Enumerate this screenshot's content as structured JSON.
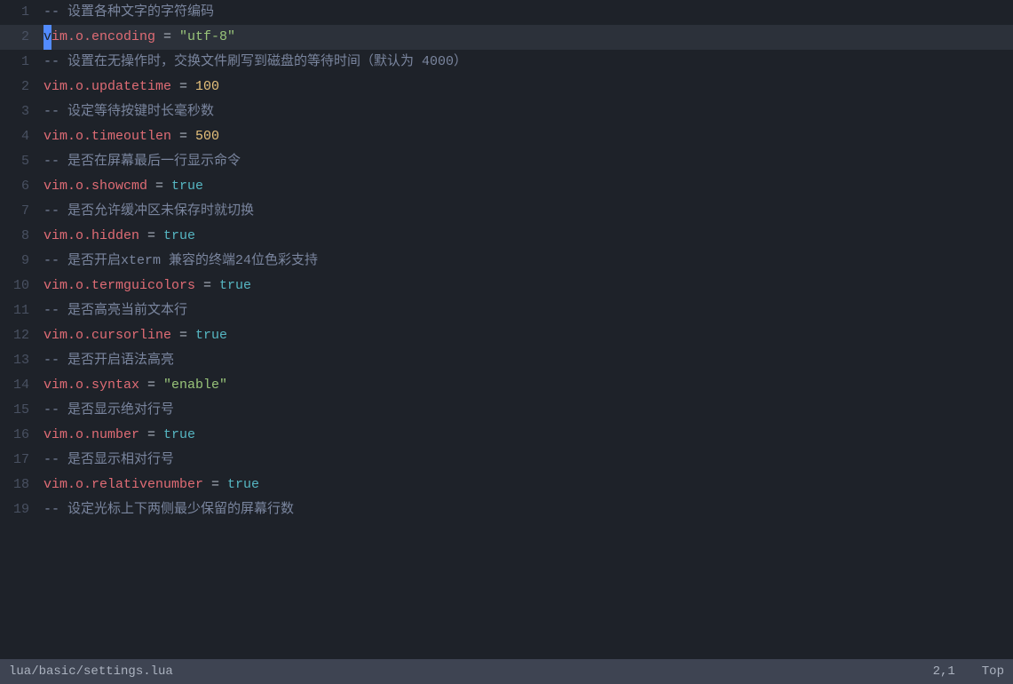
{
  "editor": {
    "lines": [
      {
        "num": "1",
        "type": "comment",
        "text": "-- 设置各种文字的字符编码",
        "isCursorLine": false
      },
      {
        "num": "2",
        "type": "code",
        "isCursorLine": true,
        "parts": [
          {
            "type": "cursor",
            "text": "v"
          },
          {
            "type": "property",
            "text": "im.o.encoding"
          },
          {
            "type": "operator",
            "text": " = "
          },
          {
            "type": "string",
            "text": "\"utf-8\""
          }
        ]
      },
      {
        "num": "1",
        "type": "comment",
        "text": "-- 设置在无操作时，交换文件刷写到磁盘的等待时间（默认为 4000）",
        "isCursorLine": false
      },
      {
        "num": "2",
        "type": "code_simple",
        "isCursorLine": false,
        "prefix": "vim.o.updatetime = ",
        "value": "100",
        "valueType": "number"
      },
      {
        "num": "3",
        "type": "comment",
        "text": "-- 设定等待按键时长毫秒数",
        "isCursorLine": false
      },
      {
        "num": "4",
        "type": "code_simple",
        "isCursorLine": false,
        "prefix": "vim.o.timeoutlen = ",
        "value": "500",
        "valueType": "number"
      },
      {
        "num": "5",
        "type": "comment",
        "text": "-- 是否在屏幕最后一行显示命令",
        "isCursorLine": false
      },
      {
        "num": "6",
        "type": "code_simple",
        "isCursorLine": false,
        "prefix": "vim.o.showcmd = ",
        "value": "true",
        "valueType": "bool"
      },
      {
        "num": "7",
        "type": "comment",
        "text": "-- 是否允许缓冲区未保存时就切换",
        "isCursorLine": false
      },
      {
        "num": "8",
        "type": "code_simple",
        "isCursorLine": false,
        "prefix": "vim.o.hidden = ",
        "value": "true",
        "valueType": "bool"
      },
      {
        "num": "9",
        "type": "comment",
        "text": "-- 是否开启xterm 兼容的终端24位色彩支持",
        "isCursorLine": false
      },
      {
        "num": "10",
        "type": "code_simple",
        "isCursorLine": false,
        "prefix": "vim.o.termguicolors = ",
        "value": "true",
        "valueType": "bool"
      },
      {
        "num": "11",
        "type": "comment",
        "text": "-- 是否高亮当前文本行",
        "isCursorLine": false
      },
      {
        "num": "12",
        "type": "code_simple",
        "isCursorLine": false,
        "prefix": "vim.o.cursorline = ",
        "value": "true",
        "valueType": "bool"
      },
      {
        "num": "13",
        "type": "comment",
        "text": "-- 是否开启语法高亮",
        "isCursorLine": false
      },
      {
        "num": "14",
        "type": "code_simple",
        "isCursorLine": false,
        "prefix": "vim.o.syntax = ",
        "value": "\"enable\"",
        "valueType": "string"
      },
      {
        "num": "15",
        "type": "comment",
        "text": "-- 是否显示绝对行号",
        "isCursorLine": false
      },
      {
        "num": "16",
        "type": "code_simple",
        "isCursorLine": false,
        "prefix": "vim.o.number = ",
        "value": "true",
        "valueType": "bool"
      },
      {
        "num": "17",
        "type": "comment",
        "text": "-- 是否显示相对行号",
        "isCursorLine": false
      },
      {
        "num": "18",
        "type": "code_simple",
        "isCursorLine": false,
        "prefix": "vim.o.relativenumber = ",
        "value": "true",
        "valueType": "bool"
      },
      {
        "num": "19",
        "type": "comment",
        "text": "-- 设定光标上下两侧最少保留的屏幕行数",
        "isCursorLine": false
      }
    ],
    "statusline": {
      "filename": "lua/basic/settings.lua",
      "position": "2,1",
      "scroll": "Top"
    }
  }
}
